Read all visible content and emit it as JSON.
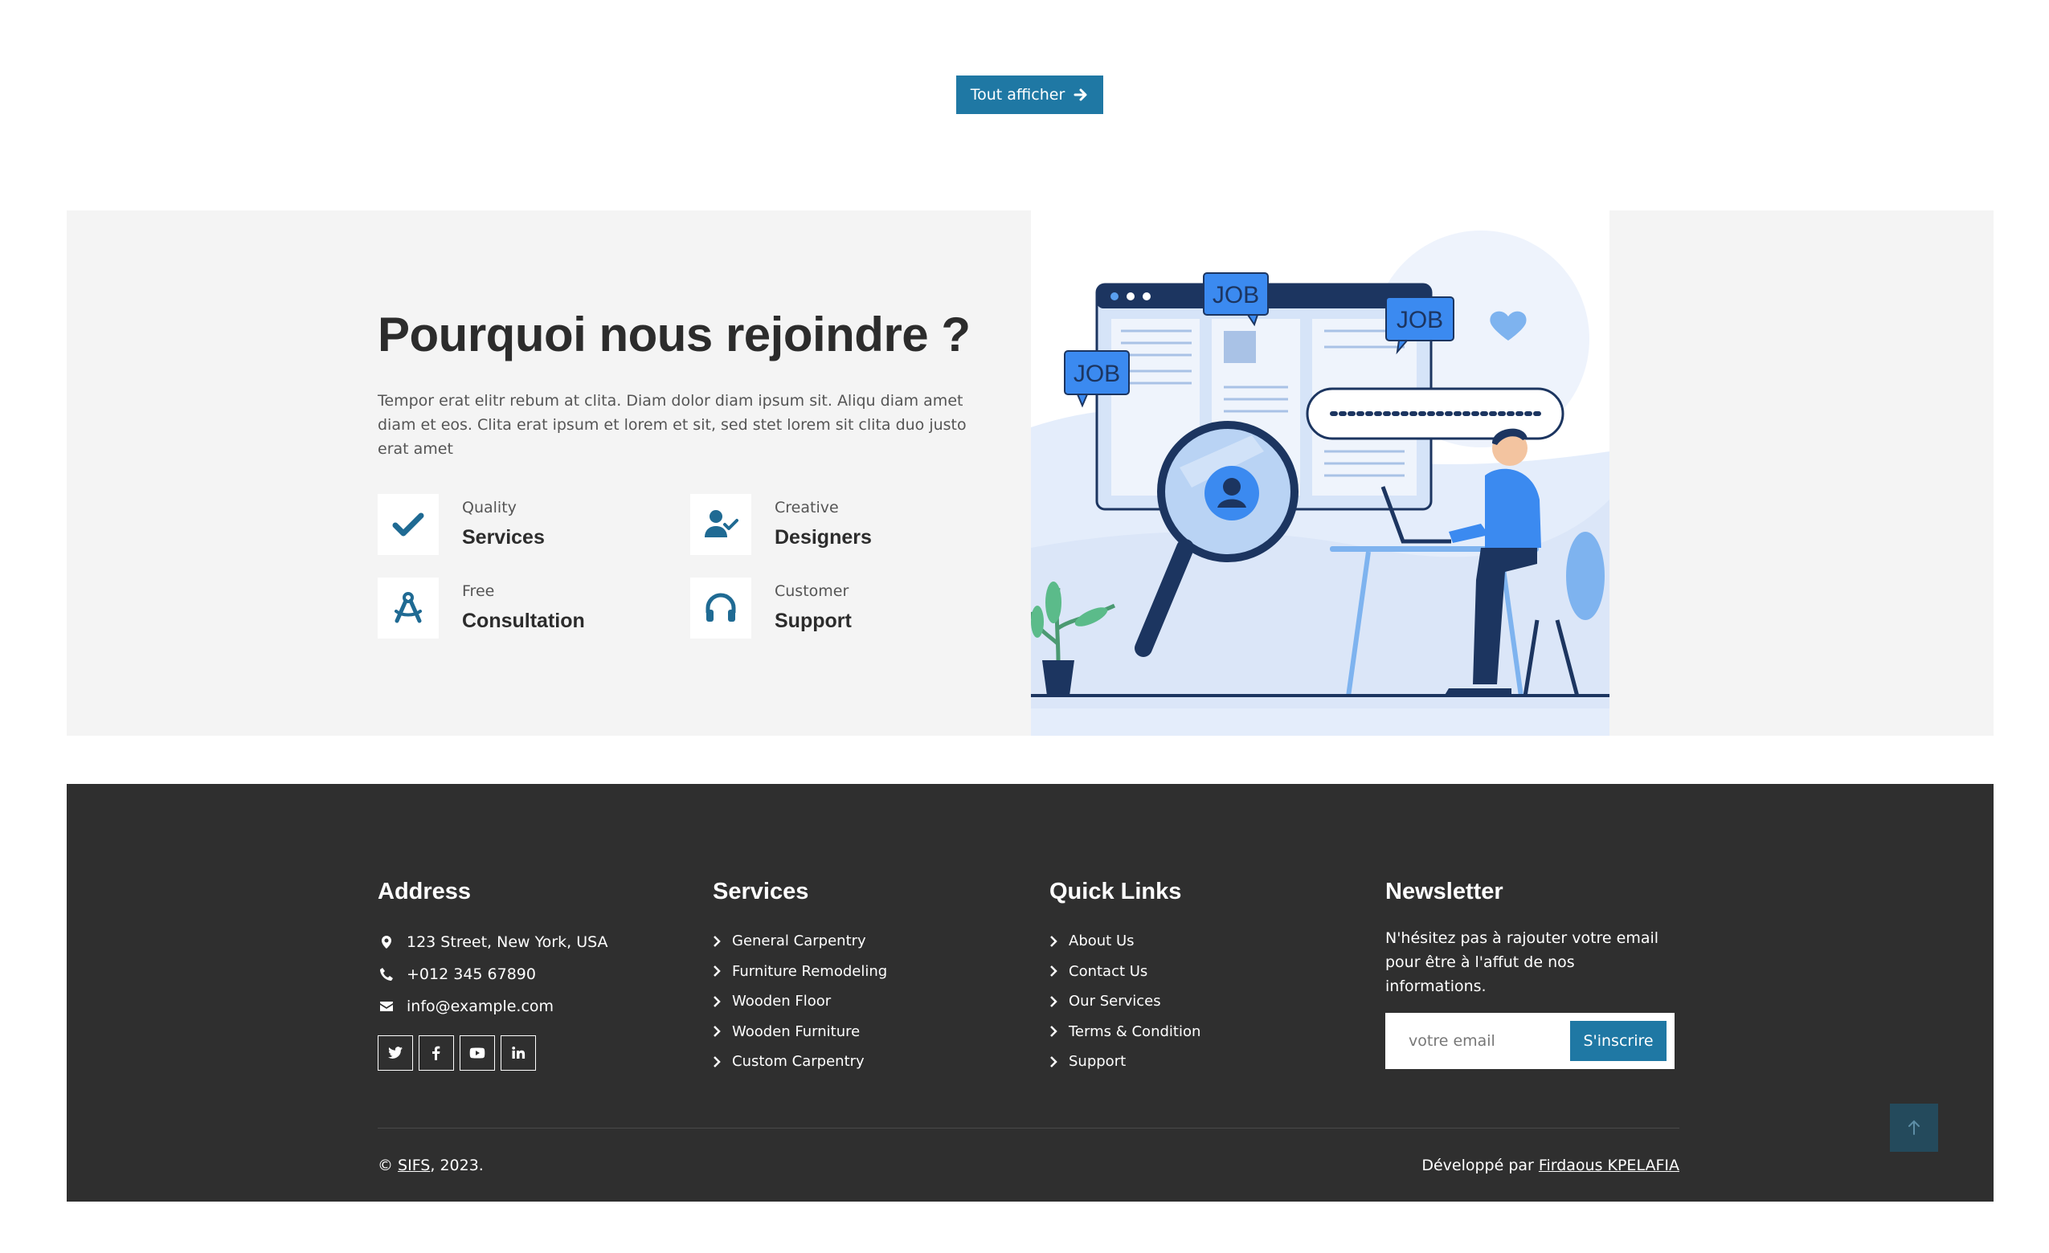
{
  "top_button": {
    "label": "Tout afficher",
    "icon": "arrow-right-icon"
  },
  "why": {
    "title": "Pourquoi nous rejoindre ?",
    "description": "Tempor erat elitr rebum at clita. Diam dolor diam ipsum sit. Aliqu diam amet diam et eos. Clita erat ipsum et lorem et sit, sed stet lorem sit clita duo justo erat amet",
    "features": [
      {
        "small": "Quality",
        "big": "Services",
        "icon": "check-icon"
      },
      {
        "small": "Creative",
        "big": "Designers",
        "icon": "user-check-icon"
      },
      {
        "small": "Free",
        "big": "Consultation",
        "icon": "drafting-compass-icon"
      },
      {
        "small": "Customer",
        "big": "Support",
        "icon": "headphones-icon"
      }
    ],
    "illustration": {
      "labels": [
        "JOB",
        "JOB",
        "JOB"
      ]
    }
  },
  "footer": {
    "address": {
      "title": "Address",
      "street": "123 Street, New York, USA",
      "phone": "+012 345 67890",
      "email": "info@example.com",
      "socials": [
        "twitter-icon",
        "facebook-icon",
        "youtube-icon",
        "linkedin-icon"
      ]
    },
    "services": {
      "title": "Services",
      "items": [
        "General Carpentry",
        "Furniture Remodeling",
        "Wooden Floor",
        "Wooden Furniture",
        "Custom Carpentry"
      ]
    },
    "quick_links": {
      "title": "Quick Links",
      "items": [
        "About Us",
        "Contact Us",
        "Our Services",
        "Terms & Condition",
        "Support"
      ]
    },
    "newsletter": {
      "title": "Newsletter",
      "text": "N'hésitez pas à rajouter votre email pour être à l'affut de nos informations.",
      "placeholder": "votre email",
      "button": "S'inscrire"
    },
    "copyright": {
      "prefix": "© ",
      "brand": "SIFS",
      "suffix": ", 2023."
    },
    "credit": {
      "prefix": "Développé par ",
      "author": "Firdaous KPELAFIA"
    }
  },
  "colors": {
    "accent": "#1f78a4",
    "footer_bg": "#2f2f2f",
    "section_bg": "#f4f4f4",
    "title": "#2c2c2c"
  }
}
